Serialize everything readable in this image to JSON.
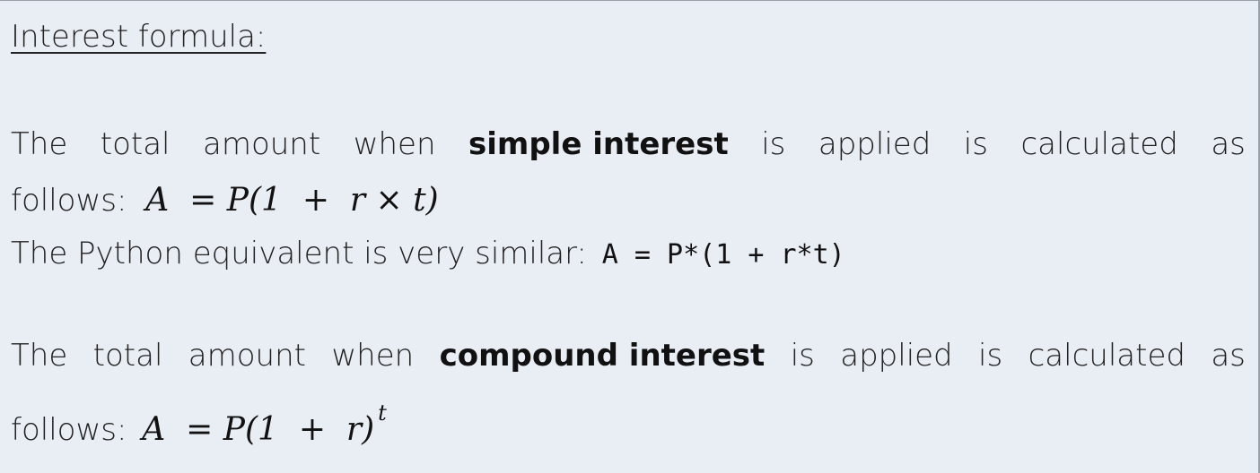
{
  "heading": "Interest formula:",
  "simple": {
    "line1": [
      "The",
      "total",
      "amount",
      "when",
      "simple interest",
      "is",
      "applied",
      "is",
      "calculated",
      "as"
    ],
    "line2_prefix": "follows:",
    "formula": "A  = P(1  +  r × t)",
    "python_prefix": "The Python equivalent is very similar:",
    "python_code": "A = P*(1 + r*t)"
  },
  "compound": {
    "line1": [
      "The",
      "total",
      "amount",
      "when",
      "compound interest",
      "is",
      "applied",
      "is",
      "calculated",
      "as"
    ],
    "line2_prefix": "follows:",
    "formula": "A  = P(1  +  r)",
    "exponent": "t"
  }
}
